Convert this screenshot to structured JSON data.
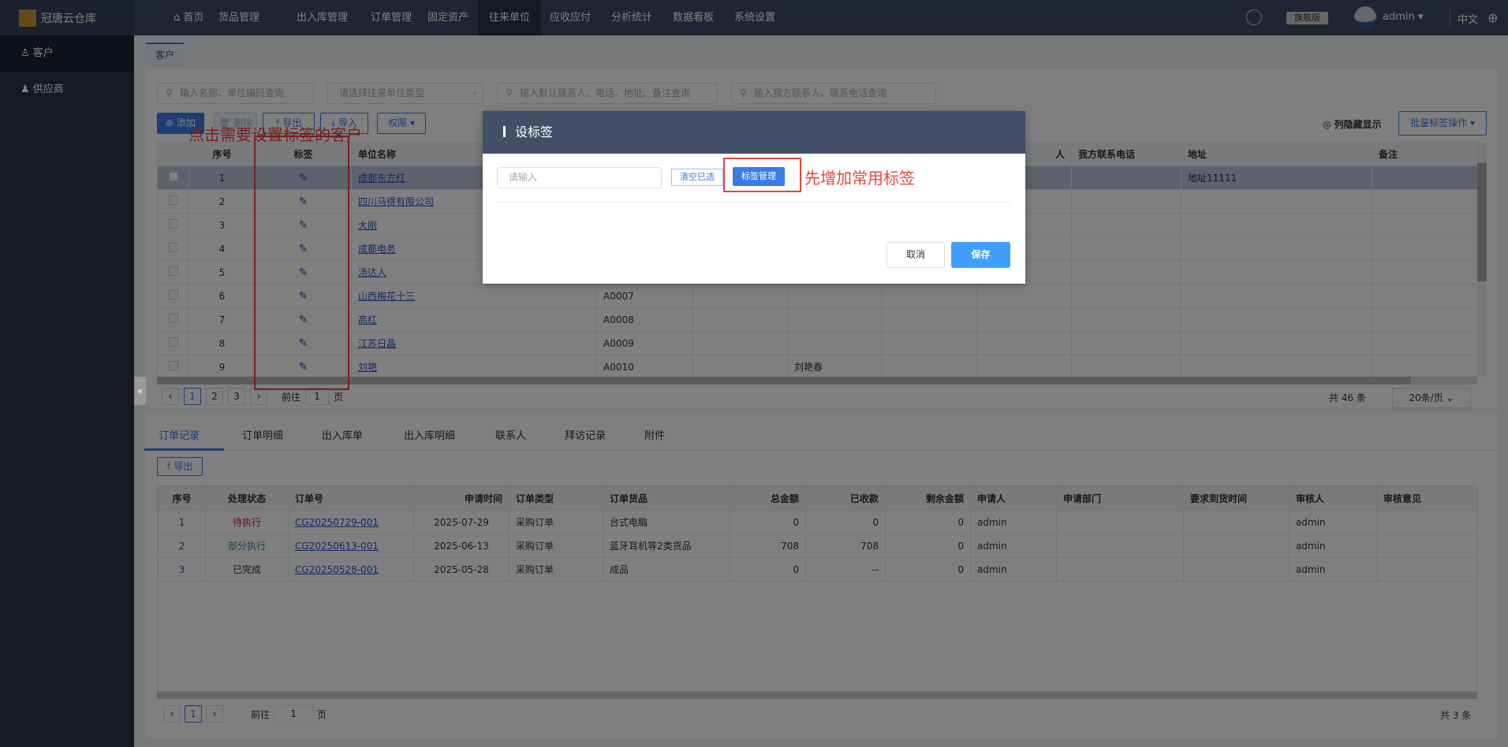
{
  "app": {
    "title": "冠唐云仓库"
  },
  "nav": [
    {
      "label": "首页"
    },
    {
      "label": "货品管理"
    },
    {
      "label": "出入库管理"
    },
    {
      "label": "订单管理"
    },
    {
      "label": "固定资产"
    },
    {
      "label": "往来单位"
    },
    {
      "label": "应收应付"
    },
    {
      "label": "分析统计"
    },
    {
      "label": "数据看板"
    },
    {
      "label": "系统设置"
    }
  ],
  "header": {
    "edition": "旗舰版",
    "user": "admin",
    "language": "中文"
  },
  "sidebar": [
    {
      "label": "客户"
    },
    {
      "label": "供应商"
    }
  ],
  "page_tab": "客户",
  "filters": {
    "name_placeholder": "输入名称、单位编码查询",
    "type_placeholder": "请选择往来单位类型",
    "contact_placeholder": "输入默认联系人、电话、地址、备注查询",
    "our_contact_placeholder": "输入我方联系人、联系电话查询"
  },
  "toolbar": {
    "add": "添加",
    "delete": "删除",
    "export": "导出",
    "import": "导入",
    "permission": "权限",
    "column_toggle": "列隐藏显示",
    "batch_tag": "批量标签操作"
  },
  "table": {
    "headers": [
      "序号",
      "标签",
      "单位名称",
      "",
      "",
      "",
      "",
      "人",
      "我方联系电话",
      "地址",
      "备注"
    ],
    "rows": [
      [
        "1",
        "成都东方红",
        "",
        "",
        "",
        "",
        "",
        "",
        "地址11111",
        ""
      ],
      [
        "2",
        "四川马得有限公司",
        "",
        "",
        "",
        "",
        "",
        "",
        "",
        ""
      ],
      [
        "3",
        "大刚",
        "",
        "",
        "",
        "",
        "",
        "",
        "",
        ""
      ],
      [
        "4",
        "成都电务",
        "",
        "",
        "",
        "",
        "",
        "",
        "",
        ""
      ],
      [
        "5",
        "汤达人",
        "",
        "",
        "",
        "",
        "",
        "",
        "",
        ""
      ],
      [
        "6",
        "山西梅花十三",
        "A0007",
        "",
        "",
        "",
        "",
        "",
        "",
        ""
      ],
      [
        "7",
        "高红",
        "A0008",
        "",
        "",
        "",
        "",
        "",
        "",
        ""
      ],
      [
        "8",
        "江苏日晶",
        "A0009",
        "",
        "",
        "",
        "",
        "",
        "",
        ""
      ],
      [
        "9",
        "刘艳",
        "A0010",
        "",
        "刘艳春",
        "",
        "",
        "",
        "",
        ""
      ]
    ]
  },
  "pagination": {
    "pages": [
      "1",
      "2",
      "3"
    ],
    "goto": "前往",
    "goto_value": "1",
    "page_unit": "页",
    "total": "共 46 条",
    "page_size": "20条/页"
  },
  "annotations": {
    "left": "点击需要设置标签的客户",
    "right": "先增加常用标签"
  },
  "modal": {
    "title": "设标签",
    "input_placeholder": "请输入",
    "clear": "清空已选",
    "manage": "标签管理",
    "cancel": "取消",
    "save": "保存"
  },
  "bottom": {
    "tabs": [
      "订单记录",
      "订单明细",
      "出入库单",
      "出入库明细",
      "联系人",
      "拜访记录",
      "附件"
    ],
    "export": "导出",
    "headers": [
      "序号",
      "处理状态",
      "订单号",
      "申请时间",
      "订单类型",
      "订单货品",
      "总金额",
      "已收款",
      "剩余金额",
      "申请人",
      "申请部门",
      "要求到货时间",
      "审核人",
      "审核意见"
    ],
    "rows": [
      [
        "1",
        "待执行",
        "CG20250729-001",
        "2025-07-29",
        "采购订单",
        "台式电脑",
        "0",
        "0",
        "0",
        "admin",
        "",
        "",
        "admin",
        ""
      ],
      [
        "2",
        "部分执行",
        "CG20250613-001",
        "2025-06-13",
        "采购订单",
        "蓝牙耳机等2类货品",
        "708",
        "708",
        "0",
        "admin",
        "",
        "",
        "admin",
        ""
      ],
      [
        "3",
        "已完成",
        "CG20250528-001",
        "2025-05-28",
        "采购订单",
        "成品",
        "0",
        "--",
        "0",
        "admin",
        "",
        "",
        "admin",
        ""
      ]
    ],
    "status_colors": {
      "待执行": "#c0206a",
      "部分执行": "#2a8a9a",
      "已完成": "#333333"
    },
    "pagination": {
      "page": "1",
      "goto": "前往",
      "goto_value": "1",
      "page_unit": "页",
      "total": "共 3 条"
    }
  }
}
